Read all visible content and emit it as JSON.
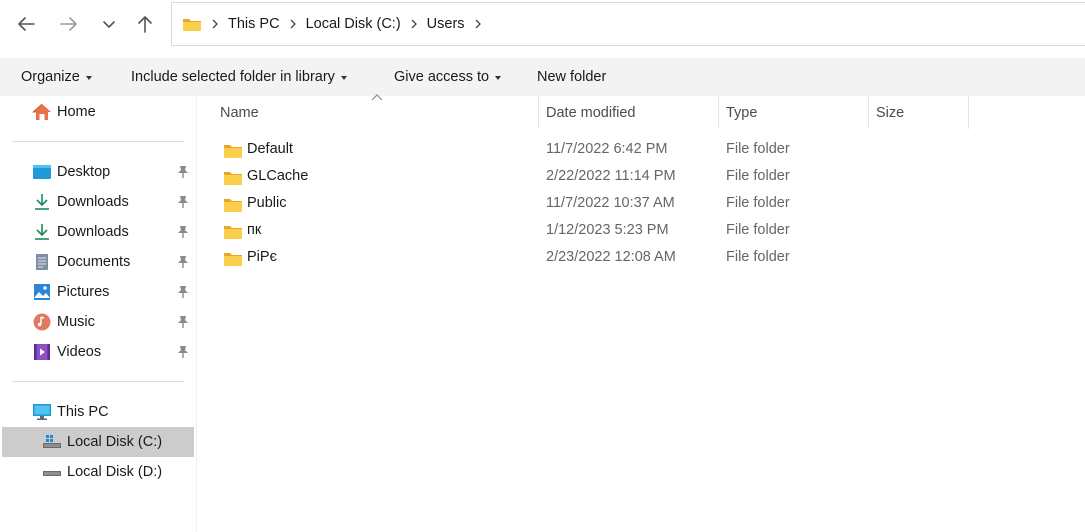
{
  "nav": {
    "back_icon": "arrow-left-icon",
    "forward_icon": "arrow-right-icon",
    "recent_icon": "chevron-down-icon",
    "up_icon": "arrow-up-icon"
  },
  "address": {
    "folder_icon": "folder-icon",
    "crumbs": [
      "This PC",
      "Local Disk (C:)",
      "Users"
    ]
  },
  "commands": {
    "organize": "Organize",
    "include_library": "Include selected folder in library",
    "give_access": "Give access to",
    "new_folder": "New folder"
  },
  "sidebar": {
    "home": "Home",
    "quick_access": [
      {
        "label": "Desktop",
        "icon": "desktop-icon"
      },
      {
        "label": "Downloads",
        "icon": "download-icon"
      },
      {
        "label": "Downloads",
        "icon": "download-icon"
      },
      {
        "label": "Documents",
        "icon": "document-icon"
      },
      {
        "label": "Pictures",
        "icon": "pictures-icon"
      },
      {
        "label": "Music",
        "icon": "music-icon"
      },
      {
        "label": "Videos",
        "icon": "videos-icon"
      }
    ],
    "this_pc": "This PC",
    "drives": [
      {
        "label": "Local Disk (C:)",
        "selected": true
      },
      {
        "label": "Local Disk (D:)",
        "selected": false
      }
    ]
  },
  "columns": {
    "name": "Name",
    "date": "Date modified",
    "type": "Type",
    "size": "Size"
  },
  "files": [
    {
      "name": "Default",
      "date": "11/7/2022 6:42 PM",
      "type": "File folder"
    },
    {
      "name": "GLCache",
      "date": "2/22/2022 11:14 PM",
      "type": "File folder"
    },
    {
      "name": "Public",
      "date": "11/7/2022 10:37 AM",
      "type": "File folder"
    },
    {
      "name": "пк",
      "date": "1/12/2023 5:23 PM",
      "type": "File folder"
    },
    {
      "name": "PiPє",
      "date": "2/23/2022 12:08 AM",
      "type": "File folder"
    }
  ],
  "colors": {
    "folder": "#f5c342",
    "selected_bg": "#cccccc",
    "cmdbar_bg": "#f3f3f3"
  }
}
